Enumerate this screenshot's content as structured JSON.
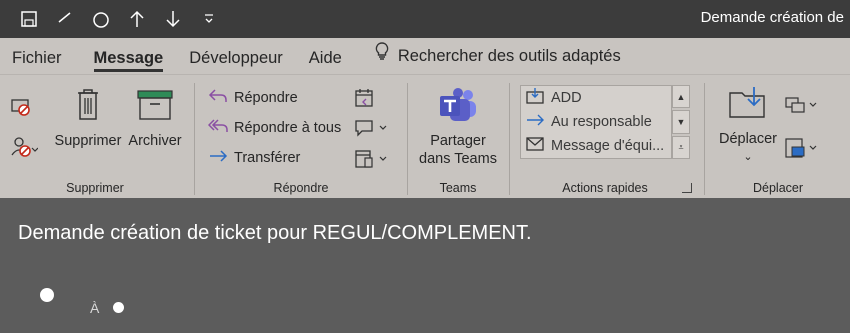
{
  "window": {
    "title": "Demande création de"
  },
  "quick_access": [
    {
      "icon": "save-icon"
    },
    {
      "icon": "undo-icon"
    },
    {
      "icon": "redo-icon"
    },
    {
      "icon": "arrow-up-icon"
    },
    {
      "icon": "arrow-down-icon"
    },
    {
      "icon": "customize-chevron-icon"
    }
  ],
  "tabs": [
    {
      "label": "Fichier",
      "active": false
    },
    {
      "label": "Message",
      "active": true
    },
    {
      "label": "Développeur",
      "active": false
    },
    {
      "label": "Aide",
      "active": false
    }
  ],
  "tell_me": {
    "label": "Rechercher des outils adaptés",
    "icon": "lightbulb-icon"
  },
  "ribbon": {
    "supprimer": {
      "label": "Supprimer",
      "delete_label": "Supprimer",
      "archive_label": "Archiver"
    },
    "repondre": {
      "label": "Répondre",
      "reply": "Répondre",
      "reply_all": "Répondre à tous",
      "forward": "Transférer"
    },
    "teams": {
      "label": "Teams",
      "share_line1": "Partager",
      "share_line2": "dans Teams"
    },
    "actions_rapides": {
      "label": "Actions rapides",
      "items": [
        "ADD",
        "Au responsable",
        "Message d'équi..."
      ]
    },
    "deplacer": {
      "label": "Déplacer",
      "move_label": "Déplacer"
    }
  },
  "message": {
    "subject": "Demande création de ticket pour REGUL/COMPLEMENT.",
    "to_label": "À"
  },
  "colors": {
    "titlebar": "#3c3c3c",
    "ribbon": "#c8c4c0",
    "reading_pane": "#5c5c5c",
    "teams_purple": "#5b5fc7",
    "reply_purple": "#8a4fa3",
    "forward_blue": "#2b6cc4",
    "delete_red": "#c42b1c",
    "archive_green": "#2e8b57"
  }
}
